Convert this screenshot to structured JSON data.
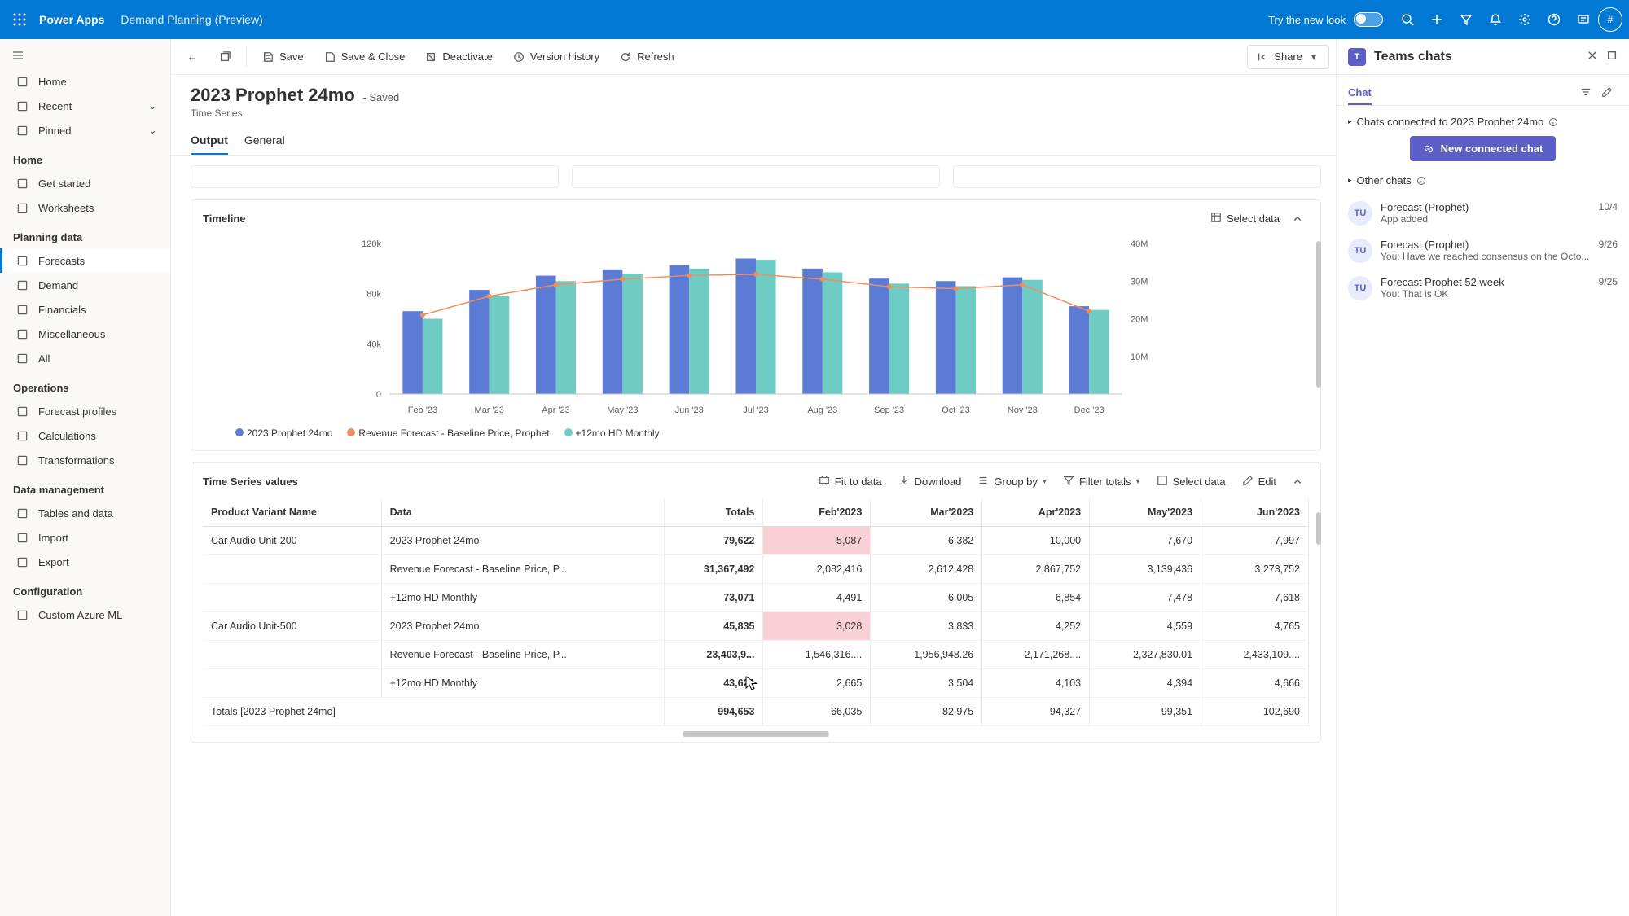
{
  "topbar": {
    "brand": "Power Apps",
    "subtitle": "Demand Planning (Preview)",
    "trylook": "Try the new look",
    "avatar_initial": "#"
  },
  "nav": {
    "items_top": [
      {
        "icon": "home",
        "label": "Home"
      },
      {
        "icon": "clock",
        "label": "Recent",
        "chev": true
      },
      {
        "icon": "pin",
        "label": "Pinned",
        "chev": true
      }
    ],
    "groups": [
      {
        "title": "Home",
        "items": [
          {
            "icon": "rocket",
            "label": "Get started"
          },
          {
            "icon": "sheet",
            "label": "Worksheets"
          }
        ]
      },
      {
        "title": "Planning data",
        "items": [
          {
            "icon": "chart",
            "label": "Forecasts",
            "selected": true
          },
          {
            "icon": "box",
            "label": "Demand"
          },
          {
            "icon": "money",
            "label": "Financials"
          },
          {
            "icon": "misc",
            "label": "Miscellaneous"
          },
          {
            "icon": "all",
            "label": "All"
          }
        ]
      },
      {
        "title": "Operations",
        "items": [
          {
            "icon": "profile",
            "label": "Forecast profiles"
          },
          {
            "icon": "calc",
            "label": "Calculations"
          },
          {
            "icon": "transform",
            "label": "Transformations"
          }
        ]
      },
      {
        "title": "Data management",
        "items": [
          {
            "icon": "table",
            "label": "Tables and data"
          },
          {
            "icon": "import",
            "label": "Import"
          },
          {
            "icon": "export",
            "label": "Export"
          }
        ]
      },
      {
        "title": "Configuration",
        "items": [
          {
            "icon": "ml",
            "label": "Custom Azure ML"
          }
        ]
      }
    ]
  },
  "cmdbar": {
    "save": "Save",
    "saveclose": "Save & Close",
    "deactivate": "Deactivate",
    "version": "Version history",
    "refresh": "Refresh",
    "share": "Share"
  },
  "record": {
    "title": "2023 Prophet 24mo",
    "status": "- Saved",
    "type": "Time Series",
    "tabs": [
      "Output",
      "General"
    ]
  },
  "timeline": {
    "title": "Timeline",
    "select_data": "Select data",
    "legend": [
      {
        "name": "2023 Prophet 24mo",
        "color": "#5b7bd5"
      },
      {
        "name": "Revenue Forecast - Baseline Price, Prophet",
        "color": "#ef8e5d"
      },
      {
        "name": "+12mo HD Monthly",
        "color": "#6fccc5"
      }
    ],
    "y_left_ticks": [
      "0",
      "40k",
      "80k",
      "120k"
    ],
    "y_right_ticks": [
      "10M",
      "20M",
      "30M",
      "40M"
    ]
  },
  "chart_data": {
    "type": "bar",
    "categories": [
      "Feb '23",
      "Mar '23",
      "Apr '23",
      "May '23",
      "Jun '23",
      "Jul '23",
      "Aug '23",
      "Sep '23",
      "Oct '23",
      "Nov '23",
      "Dec '23"
    ],
    "ylim_left": [
      0,
      120000
    ],
    "ylim_right": [
      0,
      40000000
    ],
    "series": [
      {
        "name": "2023 Prophet 24mo",
        "axis": "left",
        "color": "#5b7bd5",
        "values": [
          66035,
          82975,
          94327,
          99351,
          102690,
          108000,
          100000,
          92000,
          90000,
          93000,
          70000
        ]
      },
      {
        "name": "+12mo HD Monthly",
        "axis": "left",
        "color": "#6fccc5",
        "values": [
          60000,
          78000,
          90000,
          96000,
          100000,
          107000,
          97000,
          88000,
          86000,
          91000,
          67000
        ]
      },
      {
        "name": "Revenue Forecast - Baseline Price, Prophet",
        "axis": "right",
        "type": "line",
        "color": "#ef8e5d",
        "values": [
          21000000,
          26000000,
          29000000,
          30500000,
          31500000,
          31800000,
          30500000,
          28500000,
          28000000,
          29000000,
          22000000
        ]
      }
    ]
  },
  "values_section": {
    "title": "Time Series values",
    "tools": {
      "fit": "Fit to data",
      "download": "Download",
      "groupby": "Group by",
      "filter": "Filter totals",
      "selectdata": "Select data",
      "edit": "Edit"
    }
  },
  "table": {
    "columns": [
      "Product Variant Name",
      "Data",
      "Totals",
      "Feb'2023",
      "Mar'2023",
      "Apr'2023",
      "May'2023",
      "Jun'2023"
    ],
    "rows": [
      {
        "pv": "Car Audio Unit-200",
        "data": "2023 Prophet 24mo",
        "totals": "79,622",
        "cells": [
          "5,087",
          "6,382",
          "10,000",
          "7,670",
          "7,997"
        ],
        "pink": [
          0
        ]
      },
      {
        "pv": "",
        "data": "Revenue Forecast - Baseline Price, P...",
        "totals": "31,367,492",
        "cells": [
          "2,082,416",
          "2,612,428",
          "2,867,752",
          "3,139,436",
          "3,273,752"
        ]
      },
      {
        "pv": "",
        "data": "+12mo HD Monthly",
        "totals": "73,071",
        "cells": [
          "4,491",
          "6,005",
          "6,854",
          "7,478",
          "7,618"
        ]
      },
      {
        "pv": "Car Audio Unit-500",
        "data": "2023 Prophet 24mo",
        "totals": "45,835",
        "cells": [
          "3,028",
          "3,833",
          "4,252",
          "4,559",
          "4,765"
        ],
        "pink": [
          0
        ]
      },
      {
        "pv": "",
        "data": "Revenue Forecast - Baseline Price, P...",
        "totals": "23,403,9...",
        "cells": [
          "1,546,316....",
          "1,956,948.26",
          "2,171,268....",
          "2,327,830.01",
          "2,433,109...."
        ]
      },
      {
        "pv": "",
        "data": "+12mo HD Monthly",
        "totals": "43,621",
        "cells": [
          "2,665",
          "3,504",
          "4,103",
          "4,394",
          "4,666"
        ]
      }
    ],
    "totals_row": {
      "label": "Totals [2023 Prophet 24mo]",
      "totals": "994,653",
      "cells": [
        "66,035",
        "82,975",
        "94,327",
        "99,351",
        "102,690"
      ]
    }
  },
  "teams": {
    "title": "Teams chats",
    "tab": "Chat",
    "connected_header": "Chats connected to 2023 Prophet 24mo",
    "new_btn": "New connected chat",
    "other_header": "Other chats",
    "chats": [
      {
        "name": "Forecast (Prophet)",
        "date": "10/4",
        "preview": "App added"
      },
      {
        "name": "Forecast (Prophet)",
        "date": "9/26",
        "preview": "You: Have we reached consensus on the Octo..."
      },
      {
        "name": "Forecast Prophet 52 week",
        "date": "9/25",
        "preview": "You: That is OK"
      }
    ]
  }
}
